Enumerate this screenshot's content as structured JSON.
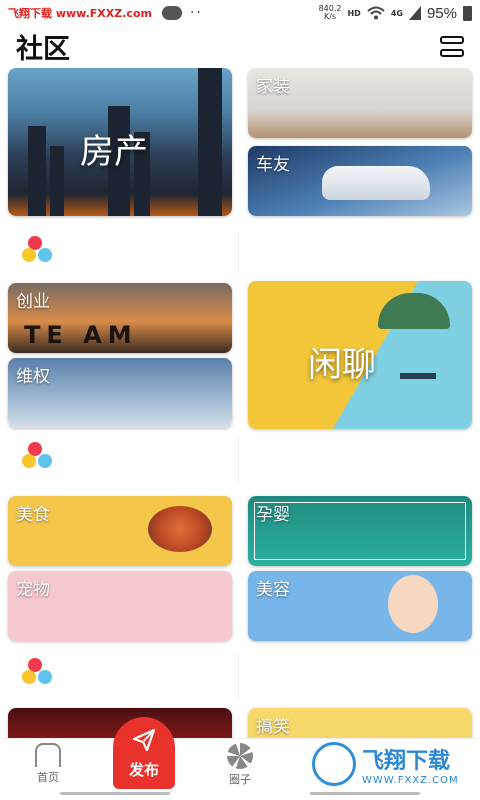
{
  "status_bar": {
    "watermark": "飞翔下载 www.FXXZ.com",
    "network_speed_value": "840.2",
    "network_speed_unit": "K/s",
    "hd": "HD",
    "signal": "4G",
    "battery": "95%"
  },
  "header": {
    "title": "社区"
  },
  "cards": {
    "fangchan": "房产",
    "jiazhuang": "家装",
    "chefu": "车友",
    "chuangye": "创业",
    "chuangye_banner": "TE    AM",
    "weiquan": "维权",
    "xianliao": "闲聊",
    "meishi": "美食",
    "yunying": "孕婴",
    "chongwu": "宠物",
    "meirong": "美容",
    "gaoxiao": "搞笑"
  },
  "colors": {
    "accent_red": "#e8322b",
    "dot_red": "#f0394a",
    "dot_blue": "#5fc4ea",
    "dot_yellow": "#f8c72d"
  },
  "bottom_nav": {
    "home_label": "首页",
    "publish_label": "发布",
    "circle_label": "圈子"
  },
  "site_logo": {
    "cn": "飞翔下载",
    "en": "WWW.FXXZ.COM"
  }
}
